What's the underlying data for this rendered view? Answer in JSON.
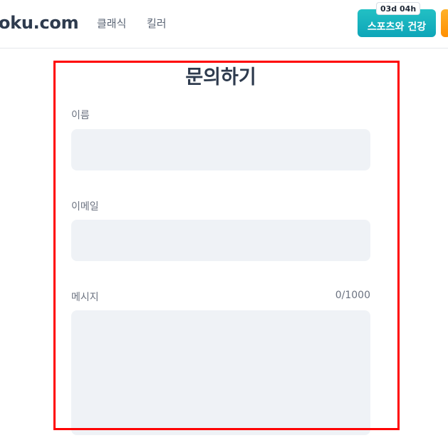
{
  "header": {
    "logo": "oku.com",
    "nav": [
      "클래식",
      "킬러"
    ],
    "event_button": "스포츠와 건강",
    "event_badge": "03d 04h"
  },
  "form": {
    "title": "문의하기",
    "name_label": "이름",
    "name_value": "",
    "email_label": "이메일",
    "email_value": "",
    "message_label": "메시지",
    "message_value": "",
    "counter": "0/1000"
  },
  "colors": {
    "highlight": "#ff0000",
    "event_button": "#0ea5b8",
    "orange_tab": "#ff8f00",
    "input_bg": "#eff2f6"
  }
}
